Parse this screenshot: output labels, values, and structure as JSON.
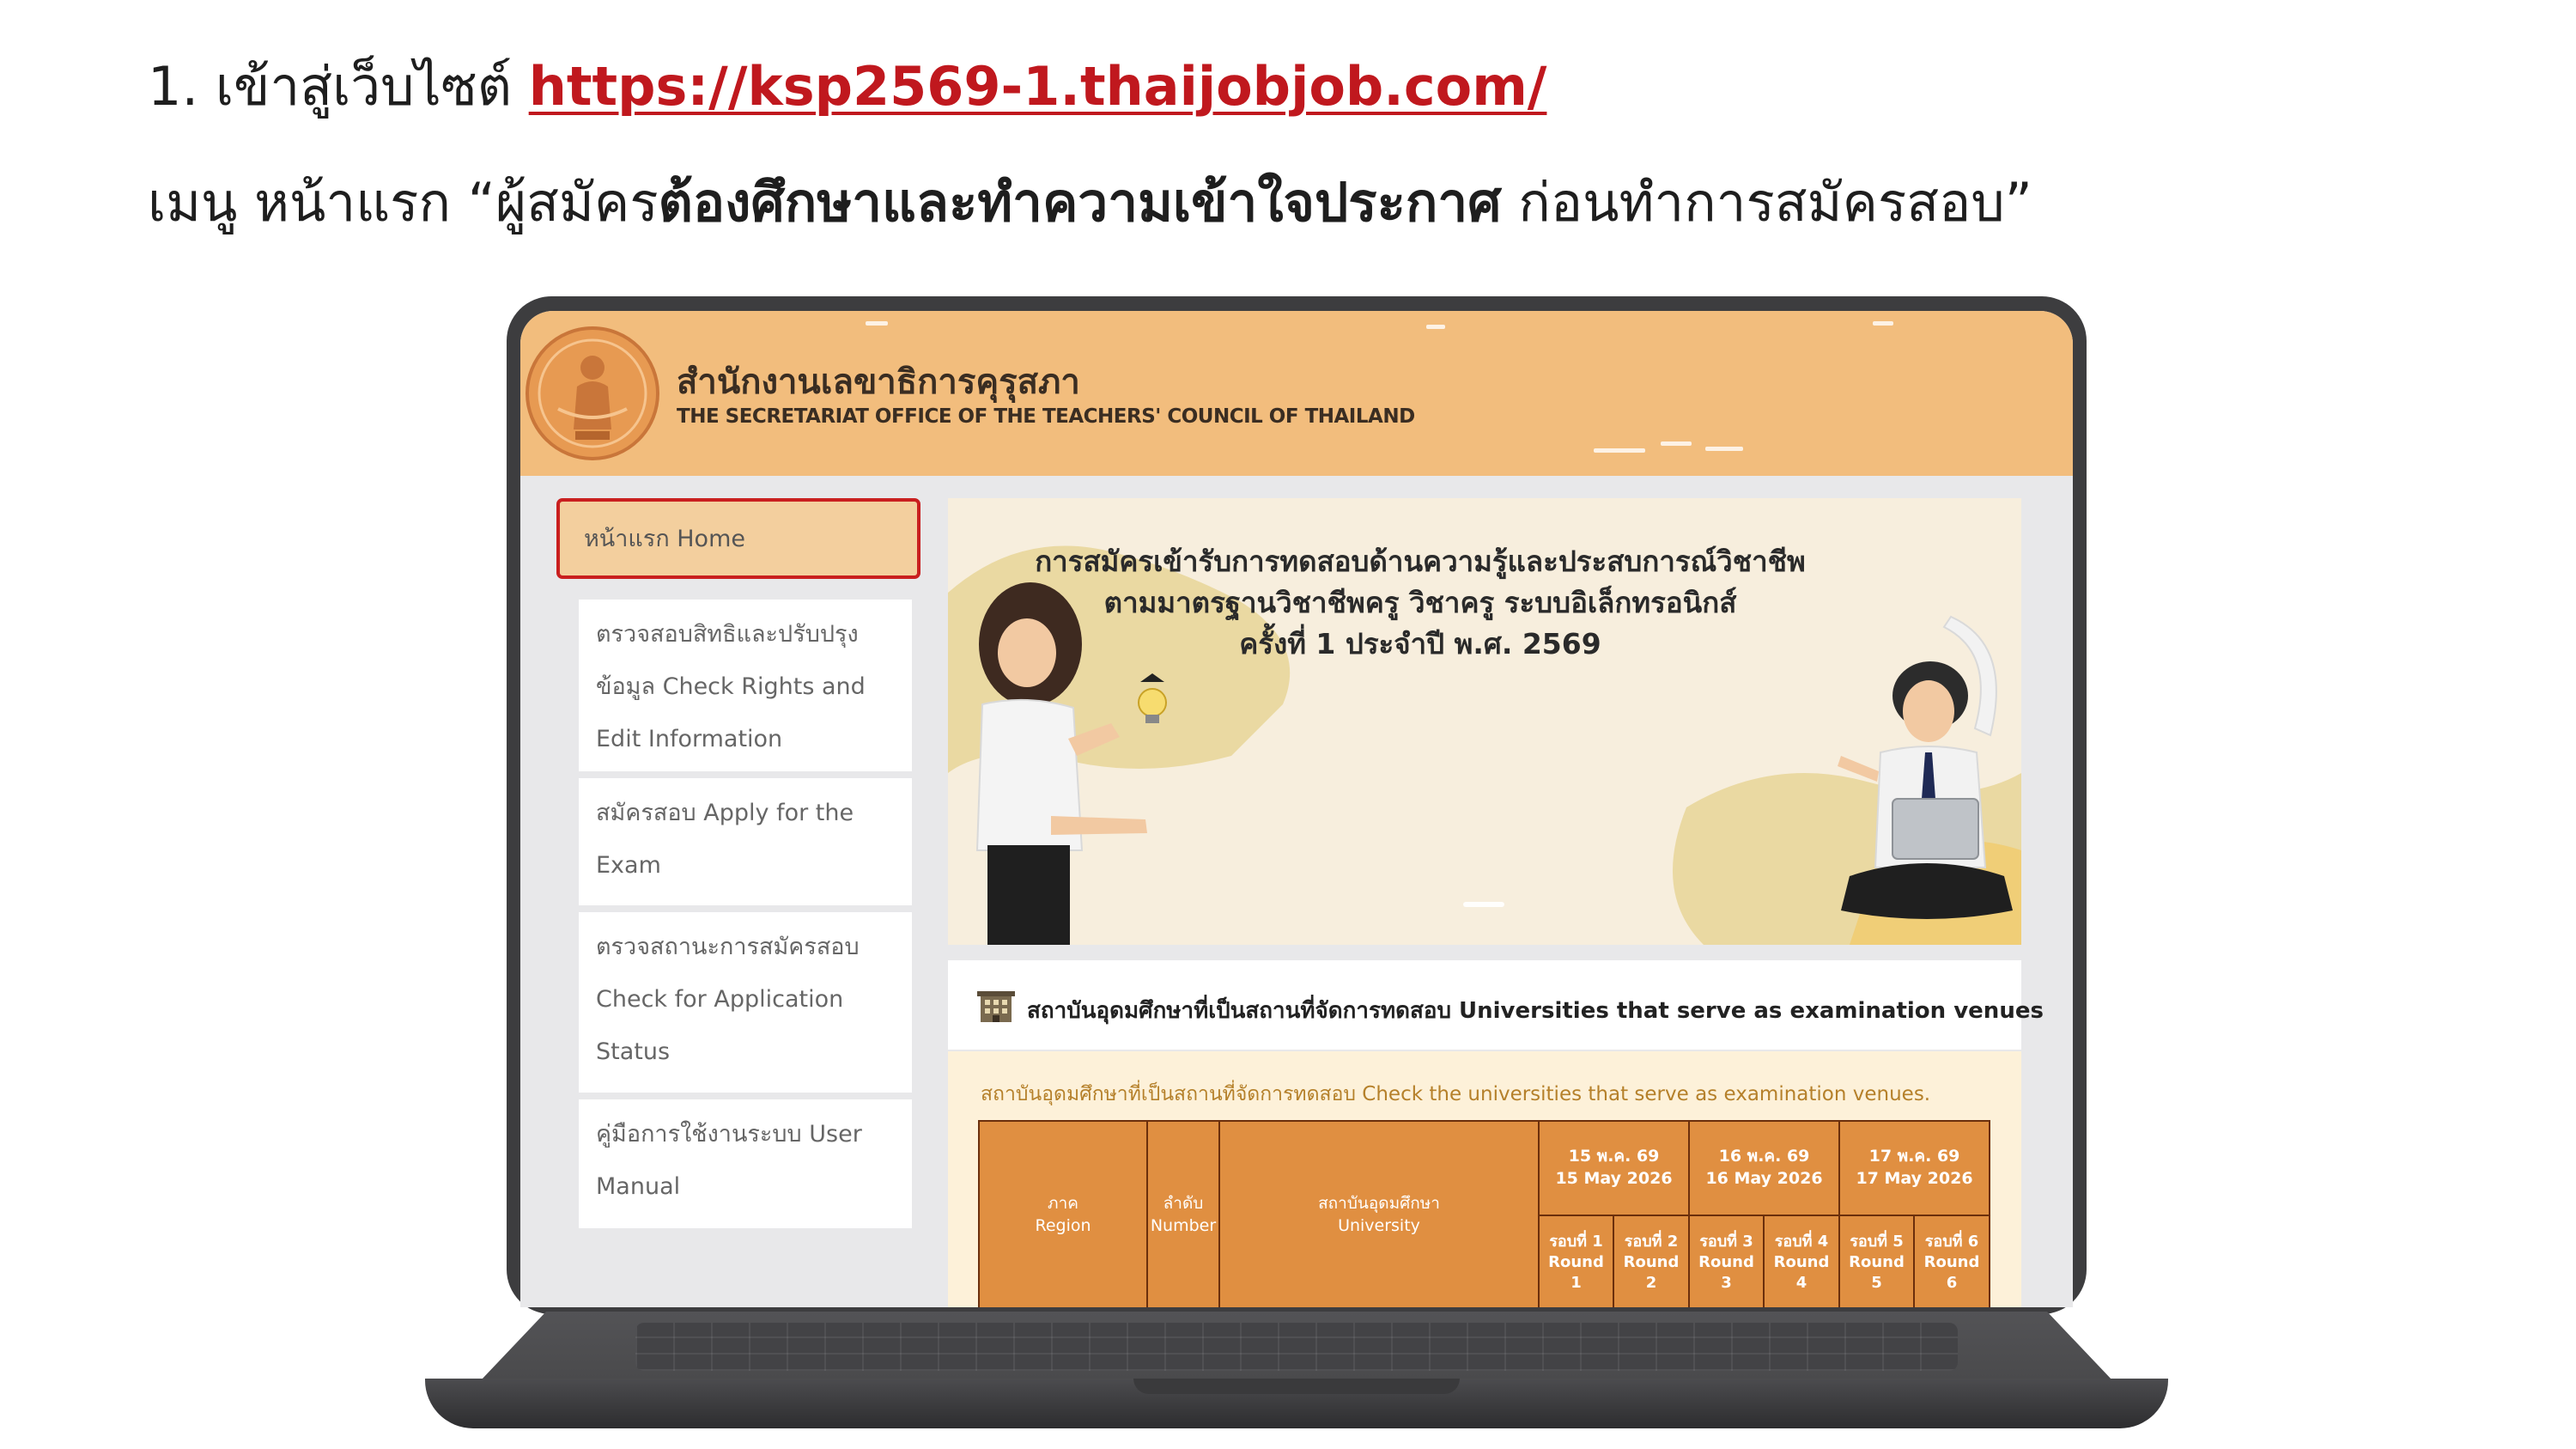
{
  "instructions": {
    "step_prefix": "1. เข้าสู่เว็บไซต์ ",
    "url": "https://ksp2569-1.thaijobjob.com/",
    "menu_prefix": "เมนู หน้าแรก “ผู้สมัคร",
    "menu_bold": "ต้องศึกษาและทำความเข้าใจประกาศ",
    "menu_suffix": " ก่อนทำการสมัครสอบ”"
  },
  "site": {
    "org_th": "สำนักงานเลขาธิการคุรุสภา",
    "org_en": "THE SECRETARIAT OFFICE OF THE TEACHERS' COUNCIL OF THAILAND",
    "logo_icon": "council-emblem-icon"
  },
  "nav": [
    {
      "label": "หน้าแรก  Home"
    },
    {
      "label": "ตรวจสอบสิทธิและปรับปรุงข้อมูล Check Rights and Edit Information"
    },
    {
      "label": "สมัครสอบ Apply for the Exam"
    },
    {
      "label": "ตรวจสถานะการสมัครสอบ Check for Application Status"
    },
    {
      "label": "คู่มือการใช้งานระบบ User Manual"
    }
  ],
  "banner": {
    "line1": "การสมัครเข้ารับการทดสอบด้านความรู้และประสบการณ์วิชาชีพ",
    "line2": "ตามมาตรฐานวิชาชีพครู วิชาครู ระบบอิเล็กทรอนิกส์",
    "line3": "ครั้งที่ 1 ประจำปี พ.ศ. 2569"
  },
  "venues": {
    "icon": "building-icon",
    "title": "สถาบันอุดมศึกษาที่เป็นสถานที่จัดการทดสอบ Universities that serve as examination venues",
    "subtitle": "สถาบันอุดมศึกษาที่เป็นสถานที่จัดการทดสอบ Check the universities that serve as examination venues.",
    "col_region_th": "ภาค",
    "col_region_en": "Region",
    "col_number_th": "ลำดับ",
    "col_number_en": "Number",
    "col_university_th": "สถาบันอุดมศึกษา",
    "col_university_en": "University",
    "dates": [
      {
        "th": "15 พ.ค. 69",
        "en": "15 May 2026"
      },
      {
        "th": "16 พ.ค. 69",
        "en": "16 May 2026"
      },
      {
        "th": "17 พ.ค. 69",
        "en": "17 May 2026"
      }
    ],
    "rounds": [
      {
        "th": "รอบที่ 1",
        "en": "Round 1"
      },
      {
        "th": "รอบที่ 2",
        "en": "Round 2"
      },
      {
        "th": "รอบที่ 3",
        "en": "Round 3"
      },
      {
        "th": "รอบที่ 4",
        "en": "Round 4"
      },
      {
        "th": "รอบที่ 5",
        "en": "Round 5"
      },
      {
        "th": "รอบที่ 6",
        "en": "Round 6"
      }
    ]
  },
  "colors": {
    "header": "#f2bd7d",
    "link": "#c0181e",
    "table_header": "#e08f41",
    "active_nav_border": "#c91f1f"
  }
}
